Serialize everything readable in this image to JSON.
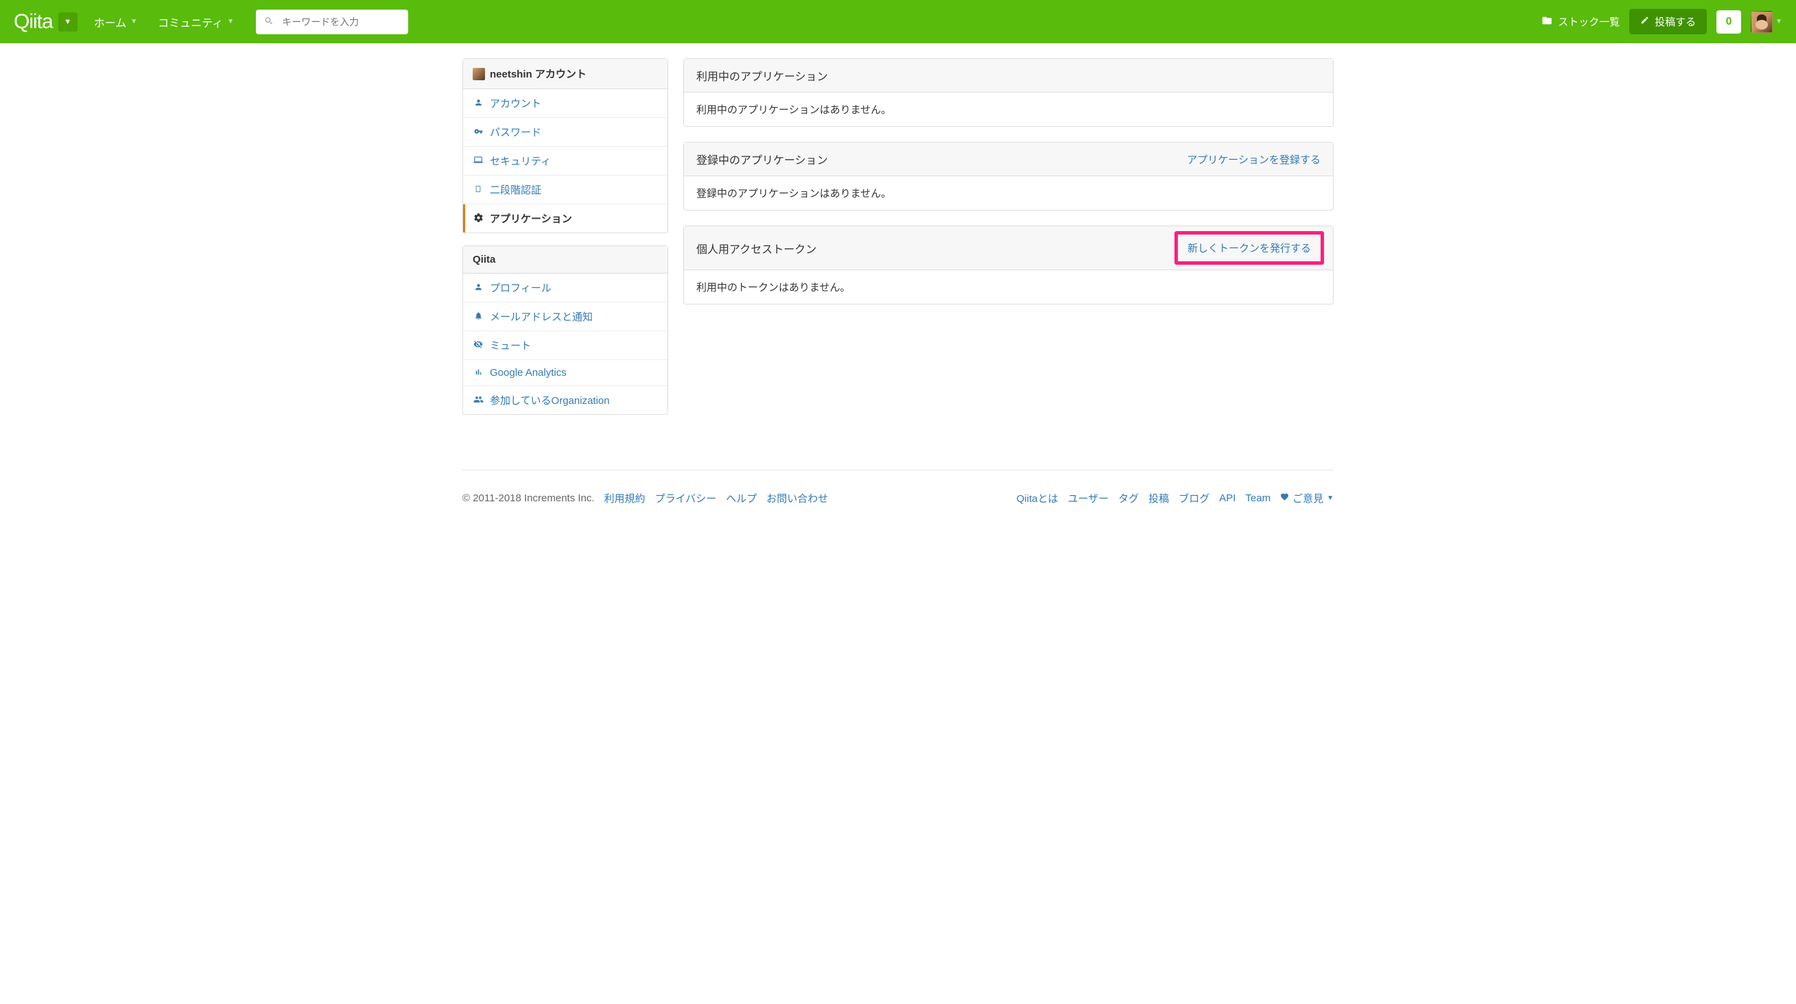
{
  "header": {
    "logo": "Qiita",
    "nav": {
      "home": "ホーム",
      "community": "コミュニティ"
    },
    "search_placeholder": "キーワードを入力",
    "stock_link": "ストック一覧",
    "post_button": "投稿する",
    "notif_count": "0"
  },
  "sidebar": {
    "account_section": {
      "title": "neetshin アカウント",
      "items": [
        {
          "label": "アカウント"
        },
        {
          "label": "パスワード"
        },
        {
          "label": "セキュリティ"
        },
        {
          "label": "二段階認証"
        },
        {
          "label": "アプリケーション"
        }
      ]
    },
    "qiita_section": {
      "title": "Qiita",
      "items": [
        {
          "label": "プロフィール"
        },
        {
          "label": "メールアドレスと通知"
        },
        {
          "label": "ミュート"
        },
        {
          "label": "Google Analytics"
        },
        {
          "label": "参加しているOrganization"
        }
      ]
    }
  },
  "main": {
    "card1": {
      "title": "利用中のアプリケーション",
      "body": "利用中のアプリケーションはありません。"
    },
    "card2": {
      "title": "登録中のアプリケーション",
      "link": "アプリケーションを登録する",
      "body": "登録中のアプリケーションはありません。"
    },
    "card3": {
      "title": "個人用アクセストークン",
      "link": "新しくトークンを発行する",
      "body": "利用中のトークンはありません。"
    }
  },
  "footer": {
    "copyright": "© 2011-2018 Increments Inc.",
    "left_links": [
      "利用規約",
      "プライバシー",
      "ヘルプ",
      "お問い合わせ"
    ],
    "right_links": [
      "Qiitaとは",
      "ユーザー",
      "タグ",
      "投稿",
      "ブログ",
      "API",
      "Team"
    ],
    "feedback": "ご意見"
  }
}
